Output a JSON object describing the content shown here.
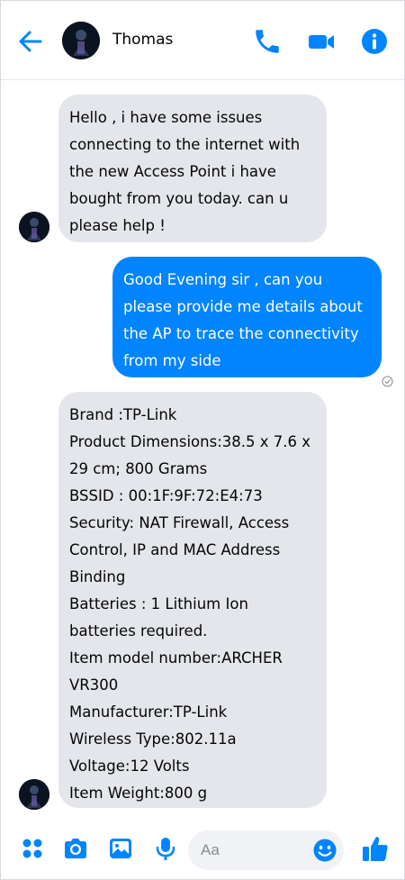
{
  "header": {
    "contact_name": "Thomas",
    "icons": [
      "back-arrow-icon",
      "avatar",
      "phone-icon",
      "video-camera-icon",
      "info-icon"
    ]
  },
  "messages": [
    {
      "direction": "incoming",
      "text": "Hello , i have some issues\nconnecting to the internet with\nthe new Access Point i have\nbought from you today. can u\nplease help !"
    },
    {
      "direction": "outgoing",
      "text": "Good Evening sir , can you\nplease provide me details about\nthe AP to trace the connectivity\nfrom my side",
      "status_icon": "seen-check-icon"
    },
    {
      "direction": "incoming",
      "text": "Brand :TP-Link\nProduct Dimensions:38.5 x 7.6 x\n29 cm; 800 Grams\nBSSID : 00:1F:9F:72:E4:73\nSecurity: NAT Firewall, Access\nControl, IP and MAC Address\nBinding\nBatteries :        1 Lithium Ion\nbatteries required.\nItem model number:ARCHER\nVR300\nManufacturer:TP-Link\nWireless Type:802.11a\nVoltage:12 Volts\nItem Weight:800 g"
    }
  ],
  "composer": {
    "placeholder": "Aa",
    "icons": [
      "menu-dots-icon",
      "camera-icon",
      "gallery-icon",
      "microphone-icon",
      "emoji-icon",
      "thumbs-up-icon"
    ]
  },
  "colors": {
    "accent": "#0084ff",
    "incoming_bubble": "#e4e6eb",
    "outgoing_text": "#ffffff"
  }
}
